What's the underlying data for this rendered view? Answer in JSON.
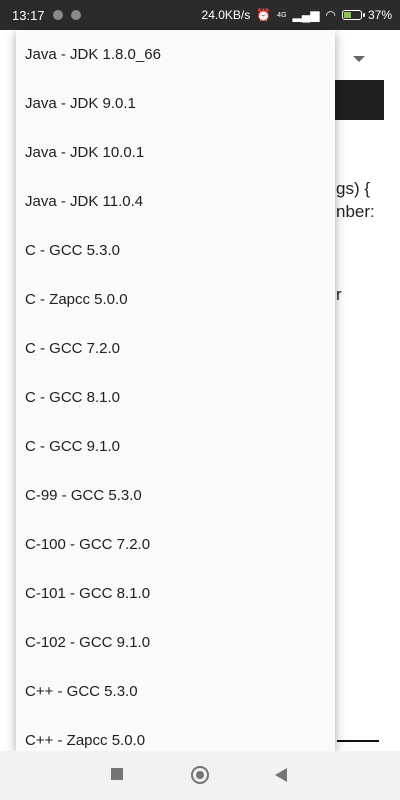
{
  "status_bar": {
    "time": "13:17",
    "network_speed": "24.0KB/s",
    "network_type": "4G",
    "battery_percent": "37%",
    "battery_level": 0.37,
    "battery_color": "#8bc34a"
  },
  "background": {
    "code_line_1": "gs) {",
    "code_line_2": "nber:",
    "code_line_3": "r"
  },
  "dropdown": {
    "options": [
      "Java - JDK 1.8.0_66",
      "Java - JDK 9.0.1",
      "Java - JDK 10.0.1",
      "Java - JDK 11.0.4",
      "C - GCC 5.3.0",
      "C - Zapcc 5.0.0",
      "C - GCC 7.2.0",
      "C - GCC 8.1.0",
      "C - GCC 9.1.0",
      "C-99 - GCC 5.3.0",
      "C-100 - GCC 7.2.0",
      "C-101 - GCC 8.1.0",
      "C-102 - GCC 9.1.0",
      "C++ - GCC 5.3.0",
      "C++ - Zapcc 5.0.0"
    ]
  },
  "nav_bar": {
    "icons": [
      "recents-square-icon",
      "home-circle-icon",
      "back-triangle-icon"
    ]
  }
}
